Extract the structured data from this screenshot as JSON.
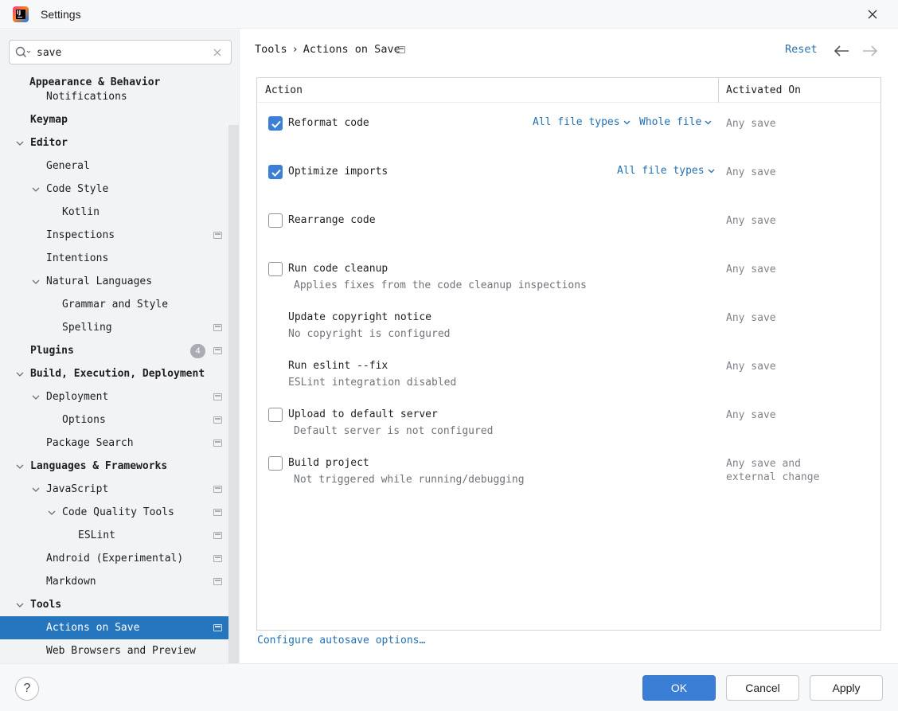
{
  "window": {
    "title": "Settings"
  },
  "search": {
    "value": "save",
    "placeholder": ""
  },
  "tree": {
    "appearance": "Appearance & Behavior",
    "notifications": "Notifications",
    "keymap": "Keymap",
    "editor": "Editor",
    "general": "General",
    "code_style": "Code Style",
    "kotlin": "Kotlin",
    "inspections": "Inspections",
    "intentions": "Intentions",
    "natural_languages": "Natural Languages",
    "grammar_style": "Grammar and Style",
    "spelling": "Spelling",
    "plugins": "Plugins",
    "plugins_badge": "4",
    "build": "Build, Execution, Deployment",
    "deployment": "Deployment",
    "options": "Options",
    "package_search": "Package Search",
    "languages": "Languages & Frameworks",
    "javascript": "JavaScript",
    "code_quality_tools": "Code Quality Tools",
    "eslint": "ESLint",
    "android": "Android (Experimental)",
    "markdown": "Markdown",
    "tools": "Tools",
    "actions_on_save": "Actions on Save",
    "web_browsers": "Web Browsers and Preview"
  },
  "header": {
    "breadcrumb": [
      "Tools",
      "Actions on Save"
    ],
    "breadcrumb_separator": "›",
    "reset": "Reset"
  },
  "table": {
    "col_action": "Action",
    "col_activated": "Activated On",
    "rows": [
      {
        "name": "Reformat code",
        "checked": true,
        "desc": "",
        "activated": "Any save",
        "dropdowns": [
          "All file types",
          "Whole file"
        ]
      },
      {
        "name": "Optimize imports",
        "checked": true,
        "desc": "",
        "activated": "Any save",
        "dropdowns": [
          "All file types"
        ]
      },
      {
        "name": "Rearrange code",
        "checked": false,
        "desc": "",
        "activated": "Any save"
      },
      {
        "name": "Run code cleanup",
        "checked": false,
        "desc": "Applies fixes from the code cleanup inspections",
        "activated": "Any save"
      },
      {
        "name": "Update copyright notice",
        "desc": "No copyright is configured",
        "activated": "Any save"
      },
      {
        "name": "Run eslint --fix",
        "desc": "ESLint integration disabled",
        "activated": "Any save"
      },
      {
        "name": "Upload to default server",
        "checked": false,
        "desc": "Default server is not configured",
        "activated": "Any save"
      },
      {
        "name": "Build project",
        "checked": false,
        "desc": "Not triggered while running/debugging",
        "activated_line1": "Any save and",
        "activated_line2": "external change"
      }
    ]
  },
  "configure_link": "Configure autosave options…",
  "footer": {
    "help": "?",
    "ok": "OK",
    "cancel": "Cancel",
    "apply": "Apply"
  },
  "colors": {
    "accent": "#2675bf",
    "link": "#2470b3",
    "primary_button": "#3a7fd5"
  }
}
